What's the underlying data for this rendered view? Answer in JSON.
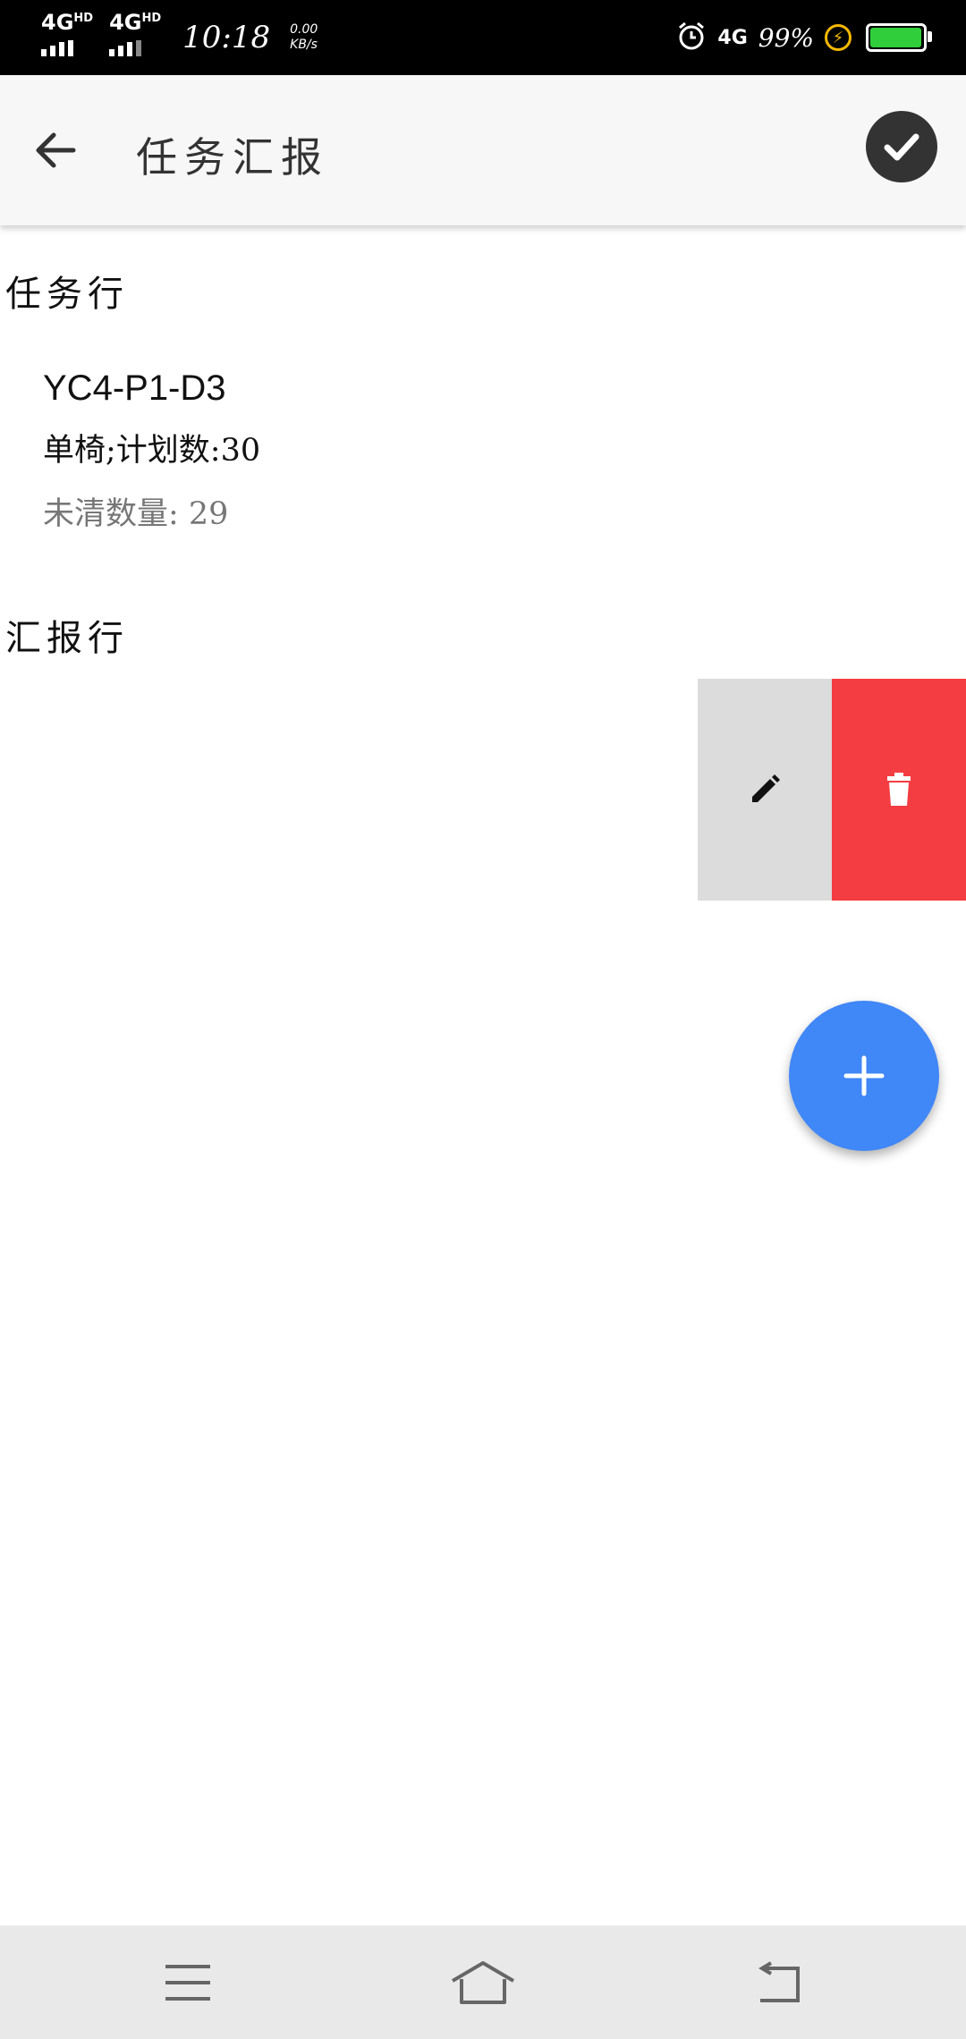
{
  "status_bar": {
    "signal1": "4G",
    "signal1_sup": "HD",
    "signal2": "4G",
    "signal2_sup": "HD",
    "time": "10:18",
    "speed_value": "0.00",
    "speed_unit": "KB/s",
    "network": "4G",
    "battery_percent": "99%",
    "battery_level": 0.99,
    "battery_color": "#2fce3a"
  },
  "app_bar": {
    "title": "任务汇报",
    "back_icon": "arrow-left-icon",
    "confirm_icon": "check-circle-icon"
  },
  "task_section": {
    "label": "任务行",
    "item": {
      "code": "YC4-P1-D3",
      "meta": "单椅;计划数:30",
      "unclear": "未清数量: 29"
    }
  },
  "report_section": {
    "label": "汇报行"
  },
  "swipe_actions": {
    "edit_icon": "pencil-icon",
    "delete_icon": "trash-icon",
    "edit_color": "#dcdcdc",
    "delete_color": "#f43d42"
  },
  "fab": {
    "icon": "plus-icon",
    "color": "#4087f7"
  },
  "nav_bar": {
    "menu_icon": "menu-icon",
    "home_icon": "home-icon",
    "back_icon": "back-icon"
  }
}
